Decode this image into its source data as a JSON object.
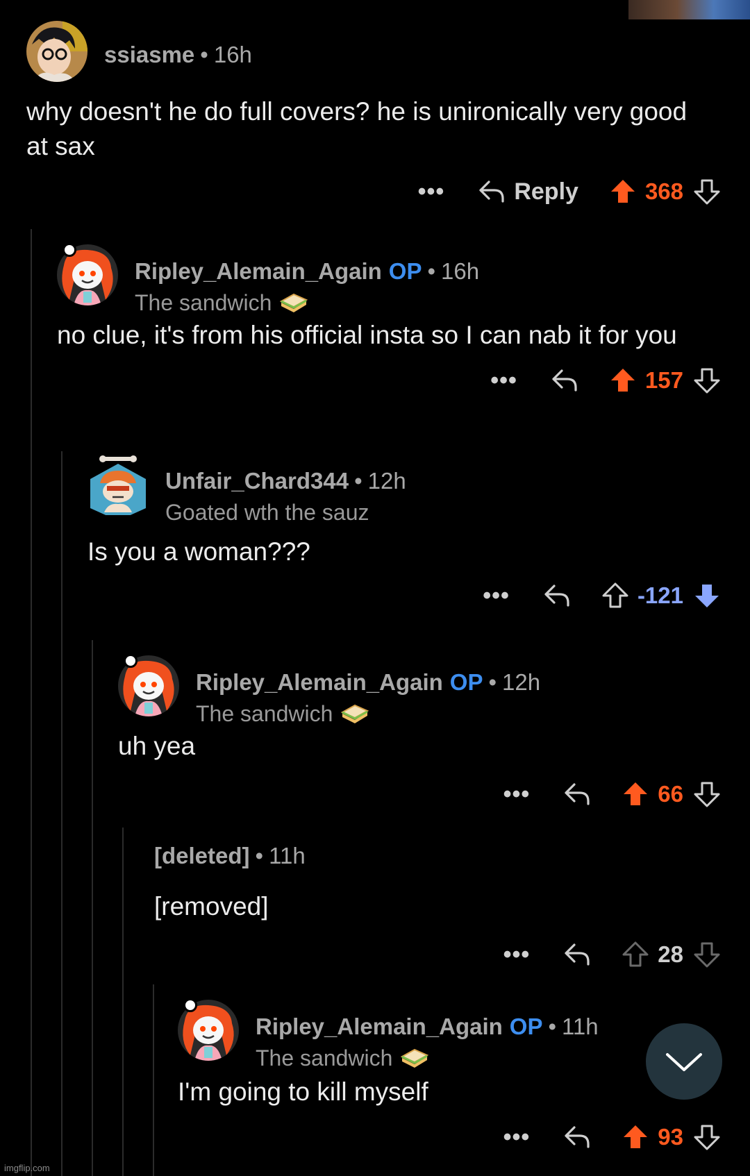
{
  "comments": [
    {
      "author": "ssiasme",
      "is_op": false,
      "time": "16h",
      "flair": "",
      "body": "why doesn't he do full covers? he is unironically very good at sax",
      "score": "368",
      "vote": "up",
      "reply_label": "Reply"
    },
    {
      "author": "Ripley_Alemain_Again",
      "is_op": true,
      "op_label": "OP",
      "time": "16h",
      "flair": "The sandwich",
      "body": "no clue, it's from his official insta so I can nab it for you",
      "score": "157",
      "vote": "up"
    },
    {
      "author": "Unfair_Chard344",
      "is_op": false,
      "time": "12h",
      "flair": "Goated wth the sauz",
      "body": "Is you a woman???",
      "score": "-121",
      "vote": "down"
    },
    {
      "author": "Ripley_Alemain_Again",
      "is_op": true,
      "op_label": "OP",
      "time": "12h",
      "flair": "The sandwich",
      "body": "uh yea",
      "score": "66",
      "vote": "up"
    },
    {
      "author": "[deleted]",
      "is_op": false,
      "time": "11h",
      "flair": "",
      "body": "[removed]",
      "score": "28",
      "vote": "none"
    },
    {
      "author": "Ripley_Alemain_Again",
      "is_op": true,
      "op_label": "OP",
      "time": "11h",
      "flair": "The sandwich",
      "body": "I'm going to kill myself",
      "score": "93",
      "vote": "up"
    }
  ],
  "more_label": "•••",
  "separator": "•",
  "watermark": "imgflip.com",
  "colors": {
    "upvote": "#ff5a1f",
    "downvote": "#8aa6ff",
    "op": "#3d8ef0",
    "background": "#000000"
  }
}
